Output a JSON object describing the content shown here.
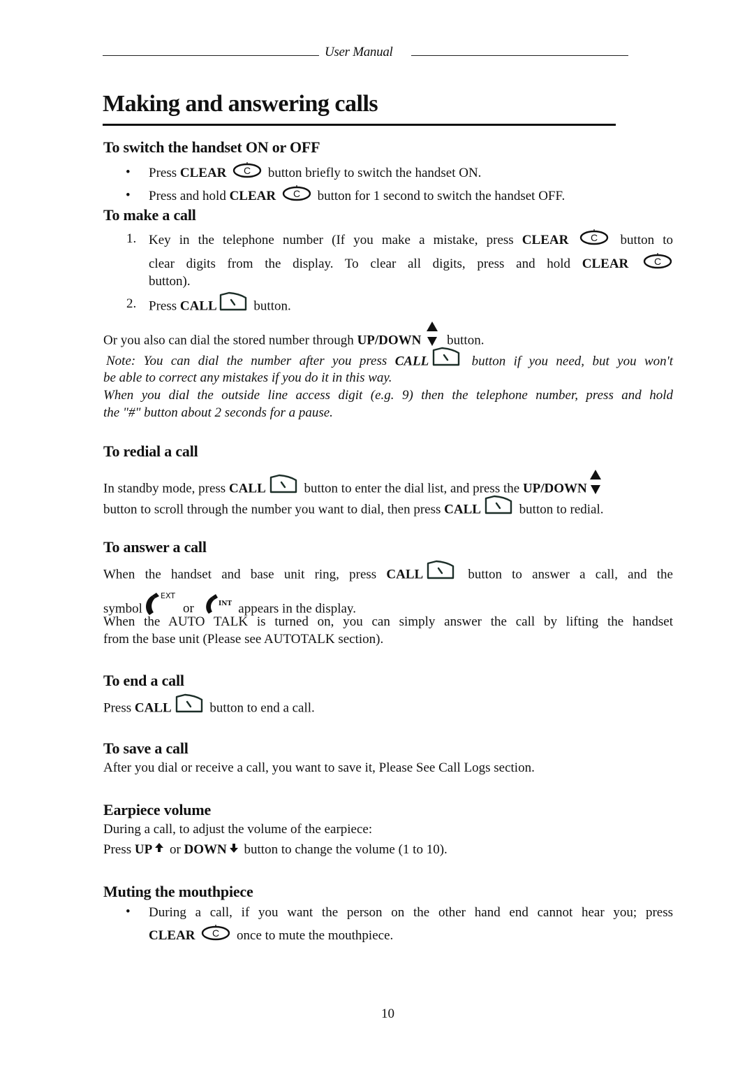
{
  "header": {
    "running_title": "User Manual"
  },
  "title": "Making and answering calls",
  "sections": {
    "switch": {
      "heading": "To switch the handset ON or OFF",
      "bullet": "•",
      "b1_pre": "Press ",
      "b1_key": "CLEAR",
      "b1_post": " button briefly to switch the handset ON.",
      "b2_pre": "Press and hold ",
      "b2_key": "CLEAR",
      "b2_post": " button for 1 second to switch the handset OFF."
    },
    "make": {
      "heading": "To make a call",
      "n1": "1.",
      "s1_pre": "Key in the telephone number (If you make a mistake, press ",
      "s1_key": "CLEAR",
      "s1_post": " button to",
      "s1_l2_pre": "clear digits from the display. To clear all digits, press and hold ",
      "s1_l2_key": "CLEAR",
      "s1_l3": "button).",
      "n2": "2.",
      "s2_pre": "Press ",
      "s2_key": "CALL",
      "s2_post": " button.",
      "or_pre": "Or you also can dial the stored number through ",
      "or_key": "UP/DOWN",
      "or_post": " button.",
      "note1_pre": "Note: You can dial the number after you press ",
      "note1_key": "CALL",
      "note1_post": " button if you need, but you won't",
      "note1_l2": "be able to correct any mistakes if you do it in this way.",
      "note2_l1": "When you dial the outside line access digit (e.g. 9) then the telephone number, press and hold",
      "note2_l2": "the \"#\" button about 2 seconds for a pause."
    },
    "redial": {
      "heading": "To redial a call",
      "l1_pre": "In standby mode, press ",
      "l1_key": "CALL",
      "l1_mid": " button to enter the dial list, and press the ",
      "l1_key2": "UP/DOWN",
      "l2_pre": "button to scroll through the number you want to dial, then press ",
      "l2_key": "CALL",
      "l2_post": " button to redial."
    },
    "answer": {
      "heading": "To answer a call",
      "l1_pre": "When the handset and base unit ring, press ",
      "l1_key": "CALL",
      "l1_post": " button to answer a call, and the",
      "l2_pre": "symbol",
      "l2_or": "or",
      "l2_post": " appears in the display.",
      "ext_label": "EXT",
      "int_label": "INT",
      "l3": "When the AUTO TALK is turned on, you can simply answer the call by lifting the handset",
      "l4": "from the base unit (Please see AUTOTALK  section)."
    },
    "end": {
      "heading": "To end a call",
      "l1_pre": "Press ",
      "l1_key": "CALL",
      "l1_post": " button to end a call."
    },
    "save": {
      "heading": "To save a call",
      "l1": "After you dial or receive a call, you want to save it, Please See Call Logs section."
    },
    "volume": {
      "heading": "Earpiece volume",
      "l1": "During a call, to adjust the volume of the earpiece:",
      "l2_pre": "Press ",
      "l2_key1": "UP",
      "l2_mid": " or ",
      "l2_key2": "DOWN",
      "l2_post": " button to change the volume (1 to 10)."
    },
    "mute": {
      "heading": "Muting the mouthpiece",
      "bullet": "•",
      "l1": "During a call, if you want the person on the other hand end cannot hear you; press",
      "l2_key": "CLEAR",
      "l2_post": " once to mute the mouthpiece."
    }
  },
  "page_number": "10"
}
